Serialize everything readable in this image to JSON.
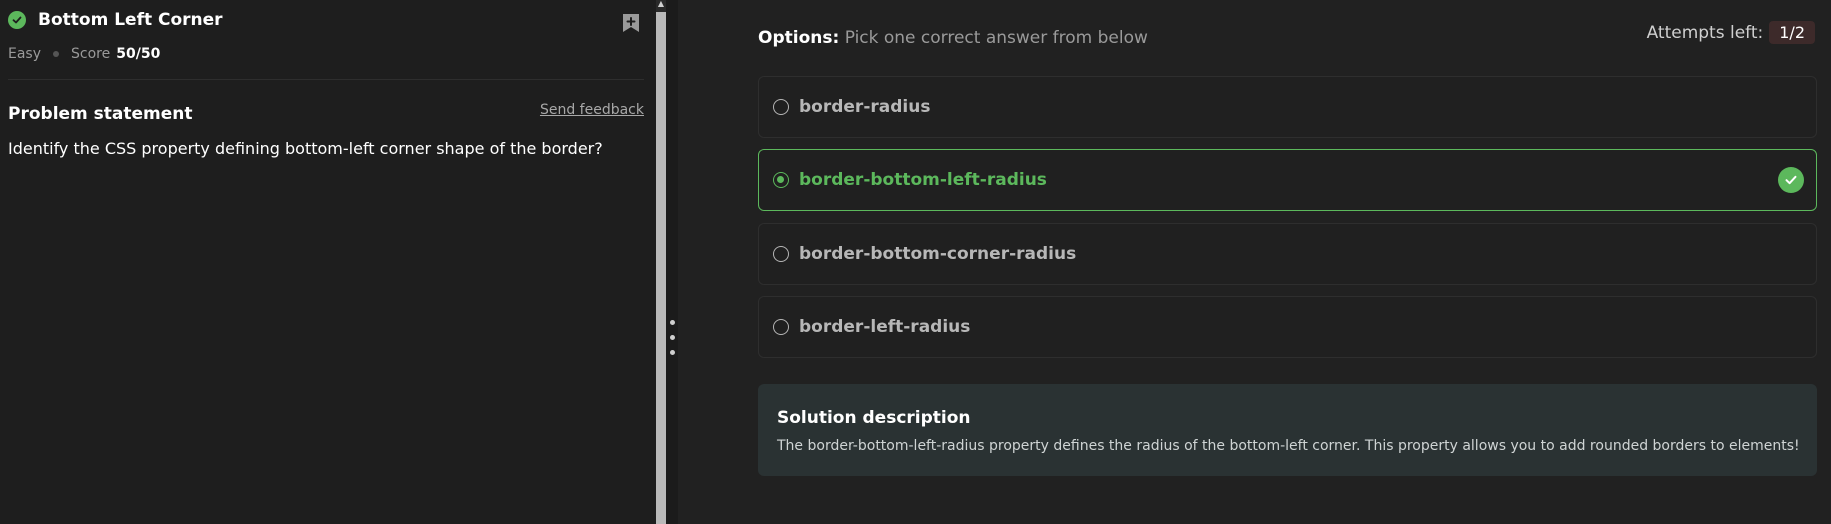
{
  "problem": {
    "title": "Bottom Left Corner",
    "difficulty": "Easy",
    "score_label": "Score",
    "score_value": "50/50",
    "statement_heading": "Problem statement",
    "feedback_link": "Send feedback",
    "statement_text": "Identify the CSS property defining bottom-left corner shape of the border?",
    "icons": {
      "status": "check-circle-icon",
      "bookmark": "bookmark-add-icon"
    }
  },
  "options_panel": {
    "label": "Options:",
    "instruction": "Pick one correct answer from below",
    "attempts_label": "Attempts left:",
    "attempts_value": "1/2",
    "options": [
      {
        "label": "border-radius",
        "selected": false
      },
      {
        "label": "border-bottom-left-radius",
        "selected": true,
        "correct": true
      },
      {
        "label": "border-bottom-corner-radius",
        "selected": false
      },
      {
        "label": "border-left-radius",
        "selected": false
      }
    ]
  },
  "solution": {
    "title": "Solution description",
    "text": "The border-bottom-left-radius property defines the radius of the bottom-left corner. This property allows you to add rounded borders to elements!"
  },
  "colors": {
    "accent_green": "#5cb85c",
    "background": "#1f1f1f",
    "solution_bg": "#2a3233",
    "attempts_badge_bg": "#3d2a2a"
  }
}
